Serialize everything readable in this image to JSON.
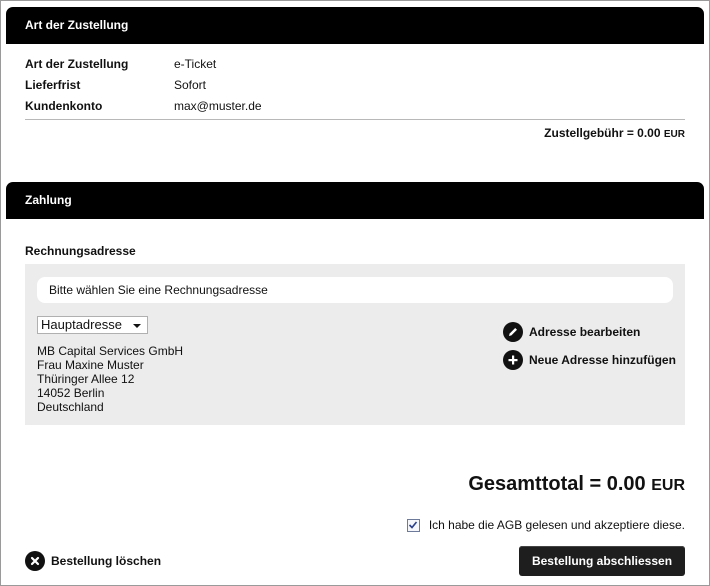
{
  "delivery": {
    "section_title": "Art der Zustellung",
    "rows": [
      {
        "label": "Art der Zustellung",
        "value": "e-Ticket"
      },
      {
        "label": "Lieferfrist",
        "value": "Sofort"
      },
      {
        "label": "Kundenkonto",
        "value": "max@muster.de"
      }
    ],
    "fee_text": "Zustellgebühr = 0.00",
    "fee_currency": "EUR"
  },
  "payment": {
    "section_title": "Zahlung",
    "billing_title": "Rechnungsadresse",
    "prompt": "Bitte wählen Sie eine Rechnungsadresse",
    "selected_address": "Hauptadresse",
    "address_lines": [
      "MB Capital Services GmbH",
      "Frau Maxine Muster",
      "Thüringer Allee 12",
      "14052 Berlin",
      "Deutschland"
    ],
    "edit_label": "Adresse bearbeiten",
    "add_label": "Neue Adresse hinzufügen"
  },
  "summary": {
    "total_text": "Gesamttotal = 0.00",
    "total_currency": "EUR",
    "agb_label": "Ich habe die AGB gelesen und akzeptiere diese.",
    "agb_checked": true,
    "delete_label": "Bestellung löschen",
    "submit_label": "Bestellung abschliessen"
  },
  "colors": {
    "header_bg": "#000000",
    "box_bg": "#ececec",
    "button_bg": "#1e1e1e"
  }
}
